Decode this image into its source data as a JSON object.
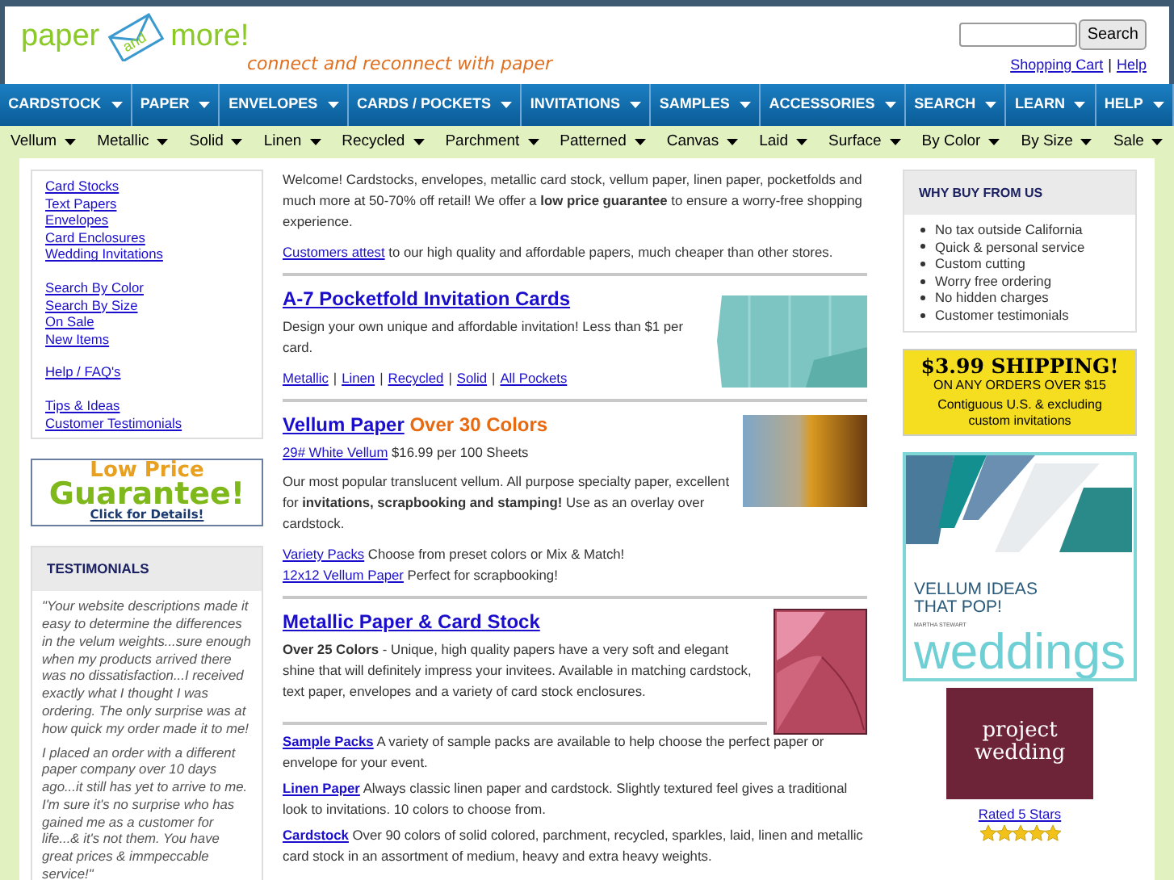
{
  "header": {
    "logo": {
      "left": "paper",
      "middle": "and",
      "right": "more!"
    },
    "tagline": "connect and reconnect with paper",
    "search": {
      "button": "Search"
    },
    "links": [
      "Shopping Cart",
      "Help"
    ],
    "separator": "|"
  },
  "nav": [
    "CARDSTOCK",
    "PAPER",
    "ENVELOPES",
    "CARDS / POCKETS",
    "INVITATIONS",
    "SAMPLES",
    "ACCESSORIES",
    "SEARCH",
    "LEARN",
    "HELP"
  ],
  "subnav": [
    "Vellum",
    "Metallic",
    "Solid",
    "Linen",
    "Recycled",
    "Parchment",
    "Patterned",
    "Canvas",
    "Laid",
    "Surface",
    "By Color",
    "By Size",
    "Sale"
  ],
  "sidebar": {
    "link_groups": [
      [
        "Card Stocks",
        "Text Papers",
        "Envelopes",
        "Card Enclosures",
        "Wedding Invitations"
      ],
      [
        "Search By Color",
        "Search By Size",
        "On Sale",
        "New Items"
      ],
      [
        "Help / FAQ's"
      ],
      [
        "Tips & Ideas",
        "Customer Testimonials"
      ]
    ],
    "guarantee": {
      "line1": "Low Price",
      "line2": "Guarantee!",
      "link": "Click for Details!"
    },
    "testimonials": {
      "title": "TESTIMONIALS",
      "quotes": [
        "\"Your website descriptions made it easy to determine the differences in the velum weights...sure enough when my products arrived there was no dissatisfaction...I received exactly what I thought I was ordering. The only surprise was at how quick my order made it to me!",
        "I placed an order with a different paper company over 10 days ago...it still has yet to arrive to me. I'm sure it's no surprise who has gained me as a customer for life...& it's not them. You have great prices & immpeccable service!\""
      ]
    }
  },
  "intro": {
    "text": "Welcome! Cardstocks, envelopes, metallic card stock, vellum paper, linen paper, pocketfolds and much more at 50-70% off retail! We offer a **low price guarantee** to ensure a worry-free shopping experience.",
    "attest_link": "Customers attest",
    "attest_text": "to our high quality and affordable papers, much cheaper than other stores."
  },
  "sections": [
    {
      "kind": "pocketfold",
      "title": "A-7 Pocketfold Invitation Cards",
      "text": "Design your own unique and affordable invitation! Less than $1 per card.",
      "links": [
        "Metallic",
        "Linen",
        "Recycled",
        "Solid",
        "All Pockets"
      ],
      "separator": "|"
    },
    {
      "kind": "vellum",
      "title": "Vellum Paper",
      "title_extra": "Over 30 Colors",
      "price_link": "29# White Vellum",
      "price": "$16.99 per 100 Sheets",
      "text": "Our most popular translucent vellum. All purpose specialty paper, excellent for **invitations, scrapbooking and stamping!** Use as an overlay over cardstock.",
      "extras": [
        {
          "link": "Variety Packs",
          "text": "Choose from preset colors or Mix & Match!"
        },
        {
          "link": "12x12 Vellum Paper",
          "text": "Perfect for scrapbooking!"
        }
      ]
    },
    {
      "kind": "metallic",
      "title": "Metallic Paper & Card Stock",
      "text": "**Over 25 Colors** - Unique, high quality papers have a very soft and elegant shine that will definitely impress your invitees. Available in matching cardstock, text paper, envelopes and a variety of card stock enclosures."
    }
  ],
  "items": [
    {
      "link": "Sample Packs",
      "text": "A variety of sample packs are available to help choose the perfect paper or envelope for your event."
    },
    {
      "link": "Linen Paper",
      "text": "Always classic linen paper and cardstock. Slightly textured feel gives a traditional look to invitations. 10 colors to choose from."
    },
    {
      "link": "Cardstock",
      "text": "Over 90 colors of solid colored, parchment, recycled, sparkles, laid, linen and metallic card stock in an assortment of medium, heavy and extra heavy weights."
    }
  ],
  "right": {
    "why": {
      "title": "WHY BUY FROM US",
      "points": [
        "No tax outside California",
        "Quick & personal service",
        "Custom cutting",
        "Worry free ordering",
        "No hidden charges",
        "Customer testimonials"
      ]
    },
    "shipping": {
      "headline": "$3.99 SHIPPING!",
      "subline": "ON ANY ORDERS OVER $15",
      "note": "Contiguous U.S. & excluding custom invitations"
    },
    "vellum_ad": {
      "headline": "VELLUM IDEAS THAT POP!",
      "brand_small": "MARTHA STEWART",
      "brand": "weddings"
    },
    "project": {
      "line1": "project",
      "line2": "wedding"
    },
    "rating": {
      "link": "Rated 5 Stars",
      "stars": 5
    }
  }
}
